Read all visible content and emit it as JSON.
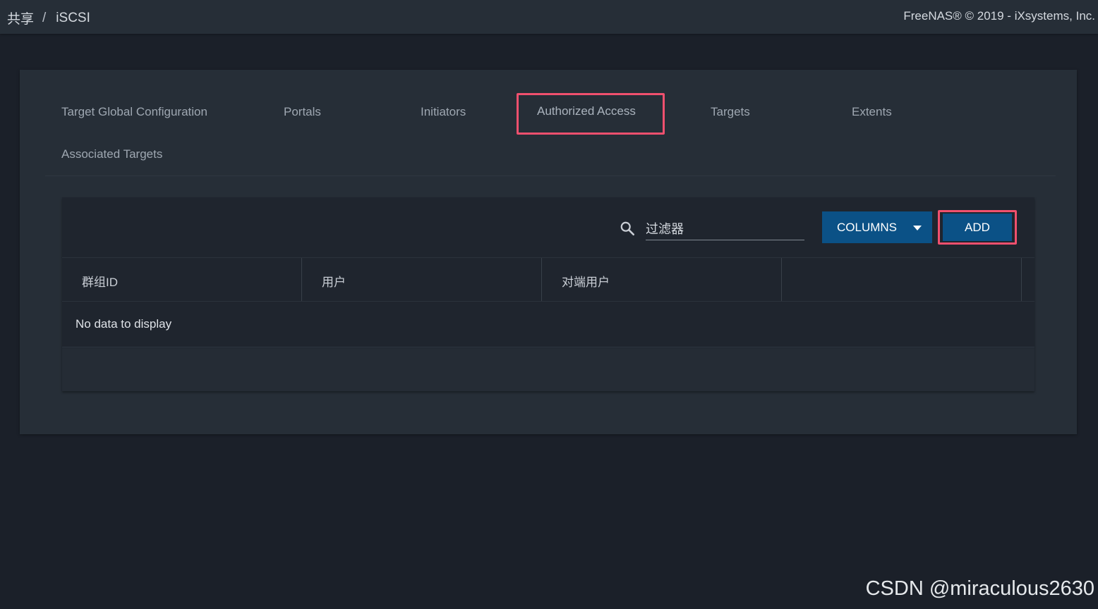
{
  "topbar": {
    "breadcrumb": [
      "共享",
      "/",
      "iSCSI"
    ],
    "copyright": "FreeNAS® © 2019 - iXsystems, Inc."
  },
  "tabs": [
    {
      "label": "Target Global Configuration",
      "active": false
    },
    {
      "label": "Portals",
      "active": false
    },
    {
      "label": "Initiators",
      "active": false
    },
    {
      "label": "Authorized Access",
      "active": true
    },
    {
      "label": "Targets",
      "active": false
    },
    {
      "label": "Extents",
      "active": false
    },
    {
      "label": "Associated Targets",
      "active": false
    }
  ],
  "toolbar": {
    "search_icon": "search-icon",
    "filter_placeholder": "过滤器",
    "columns_label": "COLUMNS",
    "add_label": "ADD"
  },
  "table": {
    "columns": [
      "群组ID",
      "用户",
      "对端用户",
      ""
    ],
    "empty_message": "No data to display"
  },
  "watermark": "CSDN @miraculous2630",
  "colors": {
    "page_bg": "#1b2029",
    "card_bg": "#262e37",
    "primary_button": "#0b5186",
    "highlight": "#f0506e"
  }
}
